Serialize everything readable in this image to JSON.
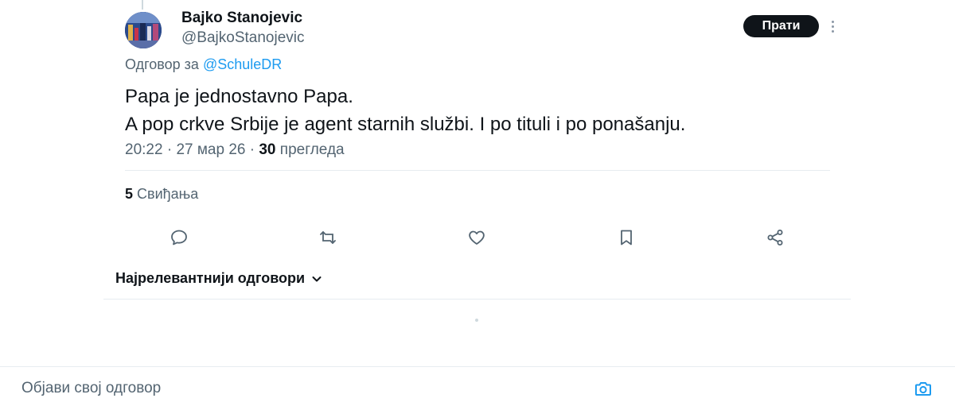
{
  "tweet": {
    "author": {
      "display_name": "Bajko Stanojevic",
      "handle": "@BajkoStanojevic"
    },
    "follow_label": "Прати",
    "reply_to_prefix": "Одговор за",
    "reply_to_handle": "@SchuleDR",
    "text_lines": [
      "Papa je jednostavno Papa.",
      "A pop crkve Srbije je agent starnih službi. I po tituli i po ponašanju."
    ],
    "meta": {
      "time": "20:22",
      "separator": "·",
      "date": "27 мар 26",
      "views_count": "30",
      "views_label": "прегледа"
    },
    "likes": {
      "count": "5",
      "label": "Свиђања"
    }
  },
  "actions": [
    {
      "name": "reply",
      "icon": "comment-icon"
    },
    {
      "name": "retweet",
      "icon": "retweet-icon"
    },
    {
      "name": "like",
      "icon": "heart-icon"
    },
    {
      "name": "bookmark",
      "icon": "bookmark-icon"
    },
    {
      "name": "share",
      "icon": "share-icon"
    }
  ],
  "replies": {
    "sort_label": "Најрелевантнији одговори"
  },
  "composer": {
    "placeholder": "Објави свој одговор"
  },
  "colors": {
    "text": "#0f1419",
    "muted": "#536471",
    "accent": "#1d9bf0",
    "icon": "#536471",
    "divider": "#e7ecf0"
  }
}
